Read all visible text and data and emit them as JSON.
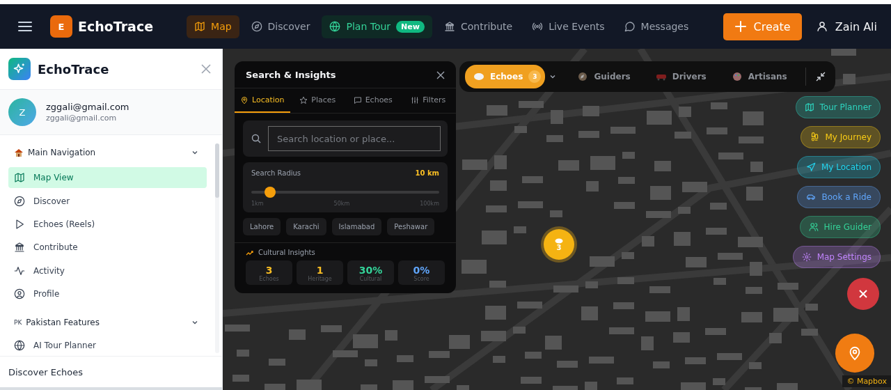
{
  "topbar": {
    "logo_letter": "E",
    "brand": "EchoTrace",
    "nav": [
      {
        "label": "Map",
        "selected": true,
        "kind": "plain"
      },
      {
        "label": "Discover",
        "selected": false,
        "kind": "plain"
      },
      {
        "label": "Plan Tour",
        "selected": false,
        "kind": "featured",
        "badge": "New"
      },
      {
        "label": "Contribute",
        "selected": false,
        "kind": "plain"
      },
      {
        "label": "Live Events",
        "selected": false,
        "kind": "plain"
      },
      {
        "label": "Messages",
        "selected": false,
        "kind": "plain"
      }
    ],
    "create_button": "Create",
    "user": "Zain Ali"
  },
  "sidebar": {
    "brand": "EchoTrace",
    "avatar_letter": "Z",
    "user_name": "zggali@gmail.com",
    "user_email": "zggali@gmail.com",
    "sections": [
      {
        "title": "Main Navigation",
        "expanded": true,
        "items": [
          {
            "label": "Map View",
            "selected": true
          },
          {
            "label": "Discover",
            "selected": false
          },
          {
            "label": "Echoes (Reels)",
            "selected": false
          },
          {
            "label": "Contribute",
            "selected": false
          },
          {
            "label": "Activity",
            "selected": false
          },
          {
            "label": "Profile",
            "selected": false
          }
        ]
      },
      {
        "title": "Pakistan Features",
        "prefix": "PK",
        "expanded": true,
        "items": [
          {
            "label": "AI Tour Planner",
            "selected": false
          }
        ]
      }
    ],
    "footer": "Discover Echoes"
  },
  "search_panel": {
    "title": "Search & Insights",
    "tabs": [
      {
        "label": "Location",
        "selected": true
      },
      {
        "label": "Places",
        "selected": false
      },
      {
        "label": "Echoes",
        "selected": false
      },
      {
        "label": "Filters",
        "selected": false
      }
    ],
    "search": {
      "placeholder": "Search location or place..."
    },
    "radius": {
      "label": "Search Radius",
      "reading": "10 km",
      "level": 0.1,
      "ticks": [
        "1km",
        "50km",
        "100km"
      ]
    },
    "cities": [
      "Lahore",
      "Karachi",
      "Islamabad",
      "Peshawar"
    ],
    "insights_title": "Cultural Insights",
    "stats": [
      {
        "value": "3",
        "label": "Echoes",
        "color": "#fbbf24"
      },
      {
        "value": "1",
        "label": "Heritage",
        "color": "#fbbf24"
      },
      {
        "value": "30%",
        "label": "Cultural",
        "color": "#34d399"
      },
      {
        "value": "0%",
        "label": "Score",
        "color": "#60a5fa"
      }
    ]
  },
  "layer_bar": [
    {
      "label": "Echoes",
      "selected": true,
      "count": "3"
    },
    {
      "label": "Guiders",
      "selected": false
    },
    {
      "label": "Drivers",
      "selected": false
    },
    {
      "label": "Artisans",
      "selected": false
    }
  ],
  "map_actions": [
    {
      "label": "Tour Planner",
      "color": "#2dd4bf"
    },
    {
      "label": "My Journey",
      "color": "#facc15"
    },
    {
      "label": "My Location",
      "color": "#22d3ee"
    },
    {
      "label": "Book a Ride",
      "color": "#60a5fa"
    },
    {
      "label": "Hire Guider",
      "color": "#34d399"
    },
    {
      "label": "Map Settings",
      "color": "#c084fc"
    }
  ],
  "marker": {
    "count": "3"
  },
  "attribution": "© Mapbox"
}
